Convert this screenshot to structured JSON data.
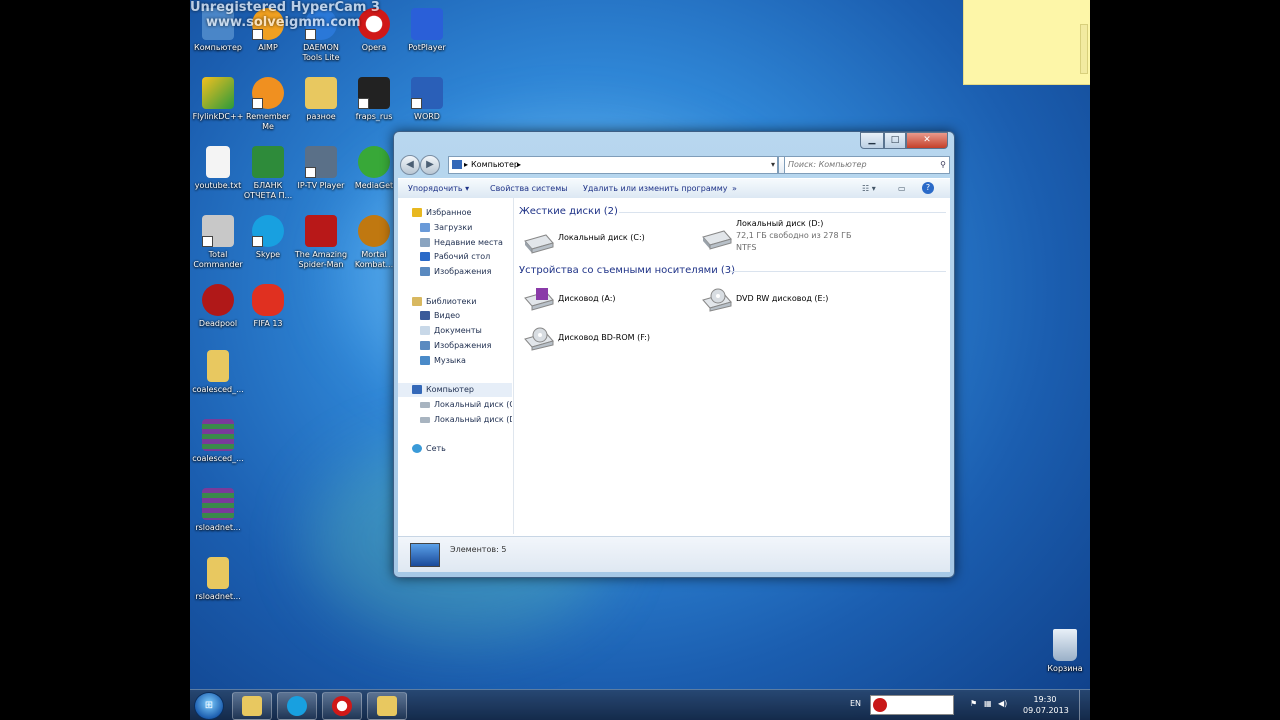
{
  "watermark": {
    "line1": "Unregistered HyperCam 3",
    "line2": "www.solveigmm.com"
  },
  "desktop_icons": [
    {
      "label": "Компьютер",
      "icon": "computer-icon",
      "color": "#4a86c8"
    },
    {
      "label": "AIMP",
      "icon": "aimp-icon",
      "color": "#f0a020"
    },
    {
      "label": "DAEMON Tools Lite",
      "icon": "daemon-tools-icon",
      "color": "#2a78d8"
    },
    {
      "label": "Opera",
      "icon": "opera-icon",
      "color": "#d01818"
    },
    {
      "label": "PotPlayer",
      "icon": "potplayer-icon",
      "color": "#2a5fd8"
    },
    {
      "label": "FlylinkDC++",
      "icon": "flylink-icon",
      "color": "#e8a818"
    },
    {
      "label": "Remember Me",
      "icon": "remember-me-icon",
      "color": "#f09020"
    },
    {
      "label": "разное",
      "icon": "folder-icon",
      "color": "#e8c860"
    },
    {
      "label": "fraps_rus",
      "icon": "fraps-icon",
      "color": "#222222"
    },
    {
      "label": "WORD",
      "icon": "word-icon",
      "color": "#2a5fb8"
    },
    {
      "label": "youtube.txt",
      "icon": "text-file-icon",
      "color": "#f4f4f4"
    },
    {
      "label": "БЛАНК ОТЧЕТА П...",
      "icon": "excel-icon",
      "color": "#2e8b3a"
    },
    {
      "label": "IP-TV Player",
      "icon": "iptv-icon",
      "color": "#5a7088"
    },
    {
      "label": "MediaGet",
      "icon": "mediaget-icon",
      "color": "#38a838"
    },
    {
      "label": "Total Commander",
      "icon": "total-commander-icon",
      "color": "#c8c8c8"
    },
    {
      "label": "Skype",
      "icon": "skype-icon",
      "color": "#18a0e0"
    },
    {
      "label": "The Amazing Spider-Man",
      "icon": "spiderman-icon",
      "color": "#b81818"
    },
    {
      "label": "Mortal Kombat...",
      "icon": "mortal-kombat-icon",
      "color": "#c07810"
    },
    {
      "label": "Deadpool",
      "icon": "deadpool-icon",
      "color": "#b01818"
    },
    {
      "label": "FIFA 13",
      "icon": "fifa-icon",
      "color": "#e03020"
    },
    {
      "label": "coalesced_...",
      "icon": "folder-icon",
      "color": "#e8c860"
    },
    {
      "label": "coalesced_...",
      "icon": "winrar-icon",
      "color": "#7a3a9a"
    },
    {
      "label": "rsloadnet...",
      "icon": "winrar-icon",
      "color": "#7a3a9a"
    },
    {
      "label": "rsloadnet...",
      "icon": "folder-icon",
      "color": "#e8c860"
    }
  ],
  "recycle_bin": {
    "label": "Корзина"
  },
  "explorer": {
    "address": "Компьютер",
    "search_placeholder": "Поиск: Компьютер",
    "toolbar": {
      "organize": "Упорядочить ▾",
      "system_props": "Свойства системы",
      "uninstall": "Удалить или изменить программу",
      "more": "»"
    },
    "nav": {
      "favorites": "Избранное",
      "downloads": "Загрузки",
      "recent": "Недавние места",
      "desktop": "Рабочий стол",
      "images_fav": "Изображения",
      "libraries": "Библиотеки",
      "video": "Видео",
      "documents": "Документы",
      "images": "Изображения",
      "music": "Музыка",
      "computer": "Компьютер",
      "disk_c": "Локальный диск (C:)",
      "disk_d": "Локальный диск (D:)",
      "network": "Сеть"
    },
    "hdd_group": "Жесткие диски (2)",
    "removable_group": "Устройства со съемными носителями (3)",
    "drives": {
      "c": {
        "name": "Локальный диск (C:)"
      },
      "d": {
        "name": "Локальный диск (D:)",
        "free": "72,1 ГБ свободно из 278 ГБ",
        "fs": "NTFS"
      },
      "a": {
        "name": "Дисковод (A:)"
      },
      "e": {
        "name": "DVD RW дисковод (E:)"
      },
      "f": {
        "name": "Дисковод BD-ROM (F:)"
      }
    },
    "status": "Элементов: 5"
  },
  "taskbar": {
    "lang": "EN",
    "time": "19:30",
    "date": "09.07.2013",
    "pinned": [
      "explorer-icon",
      "skype-icon",
      "opera-icon",
      "folder-icon"
    ]
  }
}
